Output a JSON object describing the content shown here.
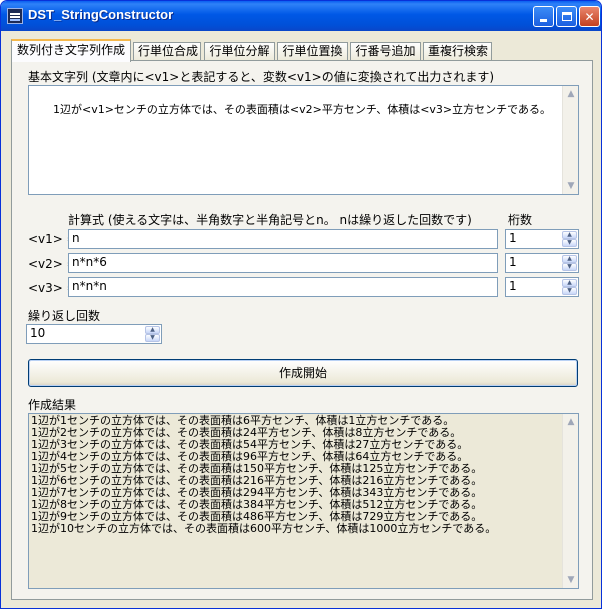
{
  "window": {
    "title": "DST_StringConstructor",
    "icon": "app-icon",
    "controls": {
      "minimize": "minimize-button",
      "maximize": "maximize-button",
      "close": "close-button"
    }
  },
  "tabs": [
    {
      "label": "数列付き文字列作成",
      "active": true
    },
    {
      "label": "行単位合成",
      "active": false
    },
    {
      "label": "行単位分解",
      "active": false
    },
    {
      "label": "行単位置換",
      "active": false
    },
    {
      "label": "行番号追加",
      "active": false
    },
    {
      "label": "重複行検索",
      "active": false
    }
  ],
  "base_string": {
    "label": "基本文字列  (文章内に<v1>と表記すると、変数<v1>の値に変換されて出力されます)",
    "value": "1辺が<v1>センチの立方体では、その表面積は<v2>平方センチ、体積は<v3>立方センチである。"
  },
  "formula": {
    "label": "計算式  (使える文字は、半角数字と半角記号とn。 nは繰り返した回数です)",
    "digits_label": "桁数",
    "vars": [
      {
        "name": "<v1> =",
        "expr": "n",
        "digits": "1"
      },
      {
        "name": "<v2> =",
        "expr": "n*n*6",
        "digits": "1"
      },
      {
        "name": "<v3> =",
        "expr": "n*n*n",
        "digits": "1"
      }
    ]
  },
  "repeat": {
    "label": "繰り返し回数",
    "value": "10"
  },
  "start_button": "作成開始",
  "result": {
    "label": "作成結果",
    "lines": [
      "1辺が1センチの立方体では、その表面積は6平方センチ、体積は1立方センチである。",
      "1辺が2センチの立方体では、その表面積は24平方センチ、体積は8立方センチである。",
      "1辺が3センチの立方体では、その表面積は54平方センチ、体積は27立方センチである。",
      "1辺が4センチの立方体では、その表面積は96平方センチ、体積は64立方センチである。",
      "1辺が5センチの立方体では、その表面積は150平方センチ、体積は125立方センチである。",
      "1辺が6センチの立方体では、その表面積は216平方センチ、体積は216立方センチである。",
      "1辺が7センチの立方体では、その表面積は294平方センチ、体積は343立方センチである。",
      "1辺が8センチの立方体では、その表面積は384平方センチ、体積は512立方センチである。",
      "1辺が9センチの立方体では、その表面積は486平方センチ、体積は729立方センチである。",
      "1辺が10センチの立方体では、その表面積は600平方センチ、体積は1000立方センチである。"
    ]
  },
  "colors": {
    "titlebar": "#0058e6",
    "window_bg": "#ece9d8",
    "active_tab_accent": "#f5b84b",
    "close_button": "#c44120"
  }
}
